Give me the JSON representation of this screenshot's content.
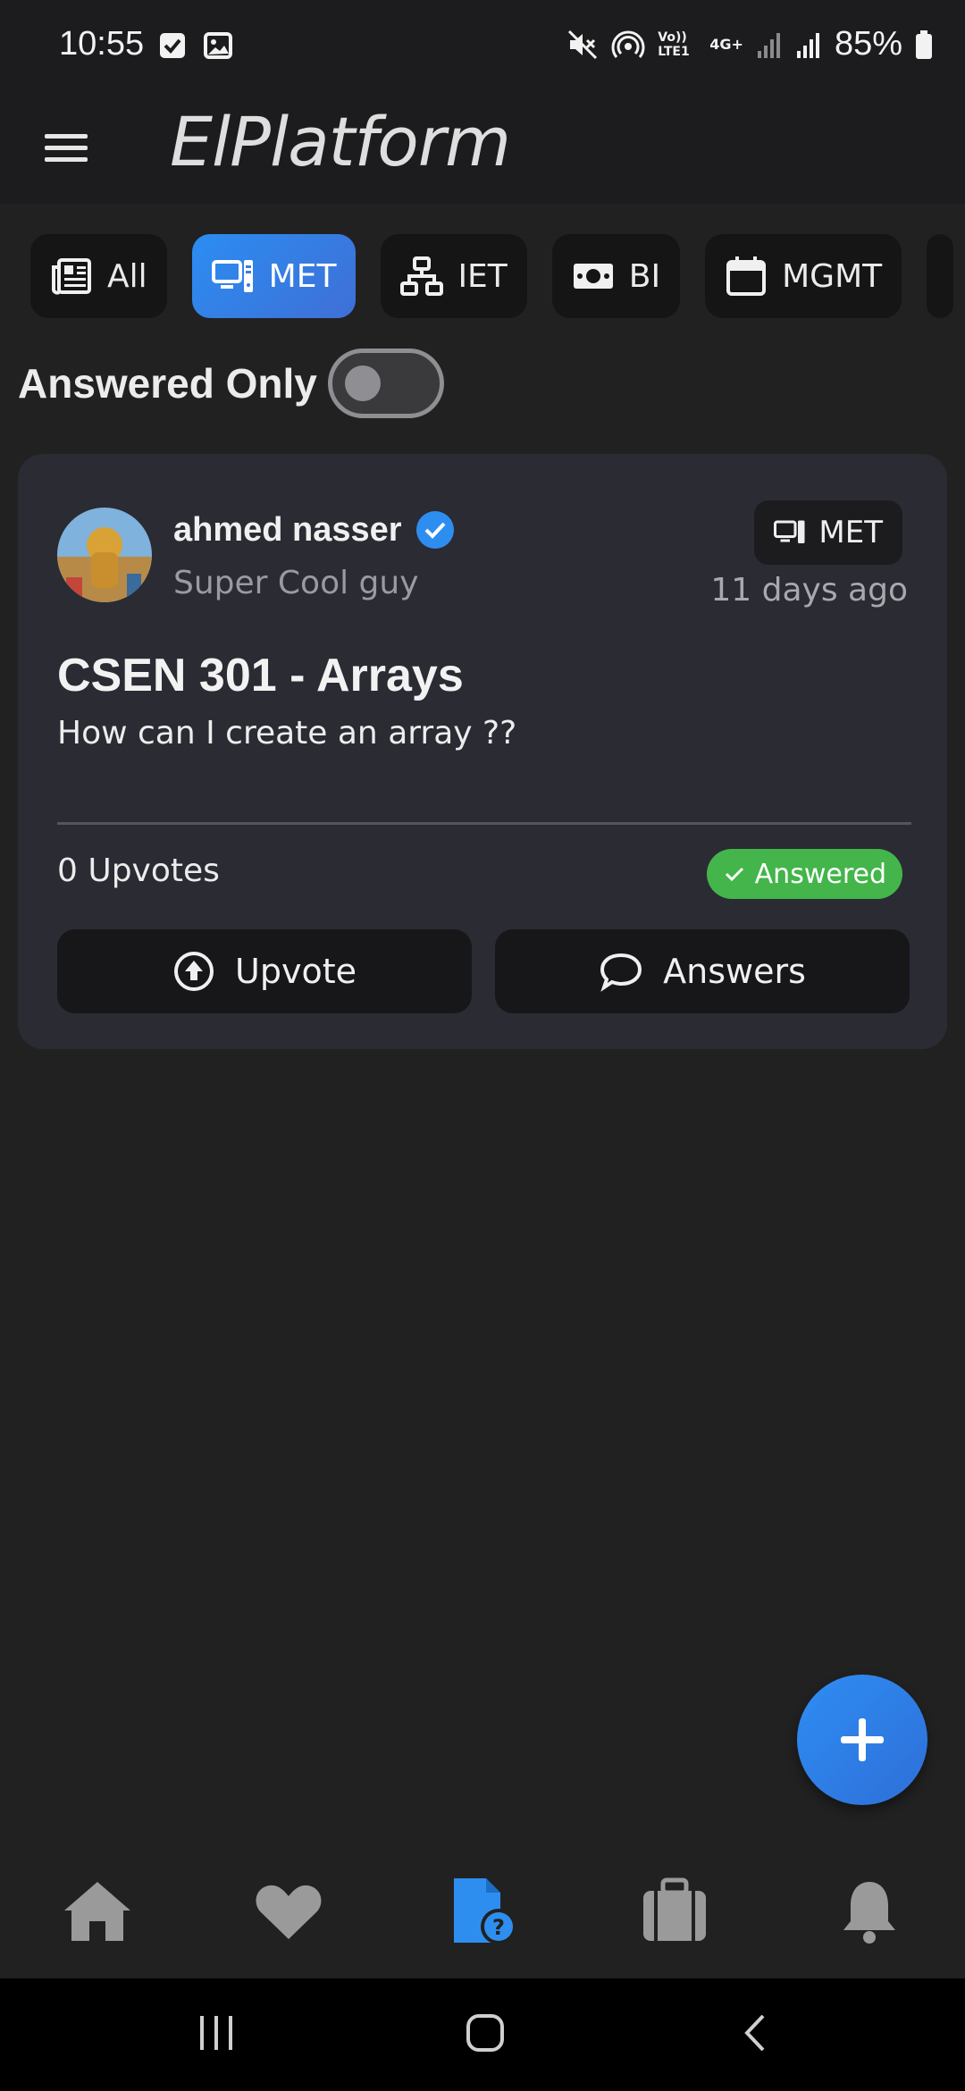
{
  "status_bar": {
    "time": "10:55",
    "signal_small": "Vo)) LTE1",
    "network": "4G+",
    "battery": "85%"
  },
  "app_bar": {
    "title": "ElPlatform",
    "menu_icon": "hamburger-icon"
  },
  "filters": {
    "chips": [
      {
        "label": "All",
        "icon": "newspaper-icon"
      },
      {
        "label": "MET",
        "icon": "computer-icon",
        "active": true
      },
      {
        "label": "IET",
        "icon": "network-icon"
      },
      {
        "label": "BI",
        "icon": "money-icon"
      },
      {
        "label": "MGMT",
        "icon": "calendar-icon"
      }
    ],
    "answered_only_label": "Answered Only",
    "answered_only": false
  },
  "question_card": {
    "author": "ahmed nasser",
    "author_subtitle": "Super Cool guy",
    "verified": true,
    "tag": "MET",
    "time_ago": "11 days ago",
    "title": "CSEN 301 - Arrays",
    "body": "How can I create an array ??",
    "upvotes": "0 Upvotes",
    "status": "Answered",
    "upvote_label": "Upvote",
    "answers_label": "Answers"
  },
  "bottom_nav": {
    "items": [
      "home-icon",
      "heart-icon",
      "question-doc-icon",
      "briefcase-icon",
      "bell-icon"
    ],
    "active": "question-doc-icon"
  },
  "colors": {
    "accent": "#2b8df2",
    "success": "#43b54a",
    "background": "#212121",
    "card": "#2a2b33"
  }
}
